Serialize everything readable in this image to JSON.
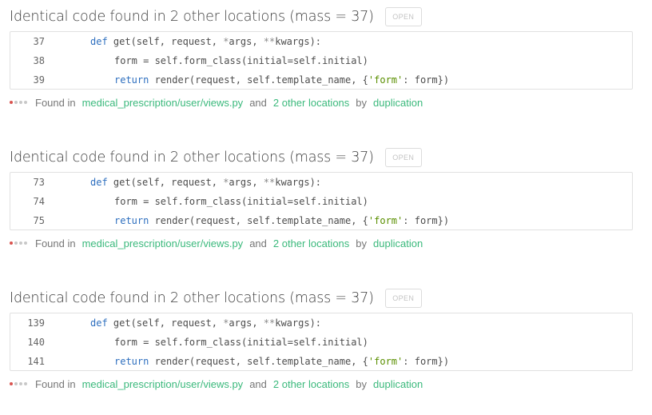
{
  "colors": {
    "link": "#3bb97c",
    "keyword": "#2e6fbf",
    "string": "#5a8f00",
    "severity_dot": "#d9534f"
  },
  "issues": [
    {
      "title": "Identical code found in 2 other locations (mass = 37)",
      "open_label": "OPEN",
      "lines": [
        {
          "num": "37",
          "indent": "",
          "kw": "def",
          "rest": " get(self, request, ",
          "op1": "*",
          "mid": "args, ",
          "op2": "**",
          "tail": "kwargs):"
        },
        {
          "num": "38",
          "indent": "    ",
          "text": "form = self.form_class(initial=self.initial)"
        },
        {
          "num": "39",
          "indent": "    ",
          "kw": "return",
          "rest": " render(request, self.template_name, {",
          "str": "'form'",
          "tail": ": form})"
        }
      ],
      "footer": {
        "found_in": "Found in",
        "path": "medical_prescription/user/views.py",
        "and": "and",
        "others": "2 other locations",
        "by": "by",
        "engine": "duplication"
      }
    },
    {
      "title": "Identical code found in 2 other locations (mass = 37)",
      "open_label": "OPEN",
      "lines": [
        {
          "num": "73",
          "indent": "",
          "kw": "def",
          "rest": " get(self, request, ",
          "op1": "*",
          "mid": "args, ",
          "op2": "**",
          "tail": "kwargs):"
        },
        {
          "num": "74",
          "indent": "    ",
          "text": "form = self.form_class(initial=self.initial)"
        },
        {
          "num": "75",
          "indent": "    ",
          "kw": "return",
          "rest": " render(request, self.template_name, {",
          "str": "'form'",
          "tail": ": form})"
        }
      ],
      "footer": {
        "found_in": "Found in",
        "path": "medical_prescription/user/views.py",
        "and": "and",
        "others": "2 other locations",
        "by": "by",
        "engine": "duplication"
      }
    },
    {
      "title": "Identical code found in 2 other locations (mass = 37)",
      "open_label": "OPEN",
      "lines": [
        {
          "num": "139",
          "indent": "",
          "kw": "def",
          "rest": " get(self, request, ",
          "op1": "*",
          "mid": "args, ",
          "op2": "**",
          "tail": "kwargs):"
        },
        {
          "num": "140",
          "indent": "    ",
          "text": "form = self.form_class(initial=self.initial)"
        },
        {
          "num": "141",
          "indent": "    ",
          "kw": "return",
          "rest": " render(request, self.template_name, {",
          "str": "'form'",
          "tail": ": form})"
        }
      ],
      "footer": {
        "found_in": "Found in",
        "path": "medical_prescription/user/views.py",
        "and": "and",
        "others": "2 other locations",
        "by": "by",
        "engine": "duplication"
      }
    }
  ]
}
